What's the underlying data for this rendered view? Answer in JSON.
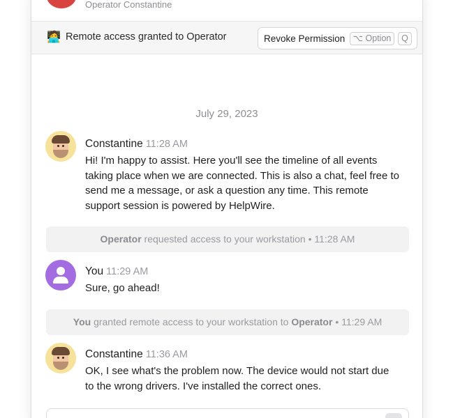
{
  "header": {
    "subtitle": "Operator Constantine"
  },
  "access_bar": {
    "icon": "computer-operator-icon",
    "text": "Remote access granted to Operator",
    "revoke_label": "Revoke Permission",
    "shortcut_option": "⌥ Option",
    "shortcut_key": "Q"
  },
  "chat": {
    "date": "July 29, 2023",
    "messages": [
      {
        "author": "Constantine",
        "time": "11:28 AM",
        "text": "Hi! I'm happy to assist. Here you'll see the timeline of all events taking place when we are connected. This is also a chat, feel free to send me a message, or ask a question any time. This remote support session is powered by HelpWire."
      },
      {
        "author": "You",
        "time": "11:29 AM",
        "text": "Sure, go ahead!"
      },
      {
        "author": "Constantine",
        "time": "11:36 AM",
        "text": "OK, I see what's the problem now. The device would not start due to the wrong drivers. I've installed the correct ones."
      }
    ],
    "events": [
      {
        "actor": "Operator",
        "text": "requested access to your workstation",
        "time": "• 11:28 AM"
      },
      {
        "actor": "You",
        "text_a": "granted remote access to your workstation to",
        "actor_b": "Operator",
        "time": "• 11:29 AM"
      }
    ]
  },
  "colors": {
    "accent_red": "#d8443f",
    "you_avatar": "#a36ce0",
    "memoji_bg": "#f6e29b"
  }
}
